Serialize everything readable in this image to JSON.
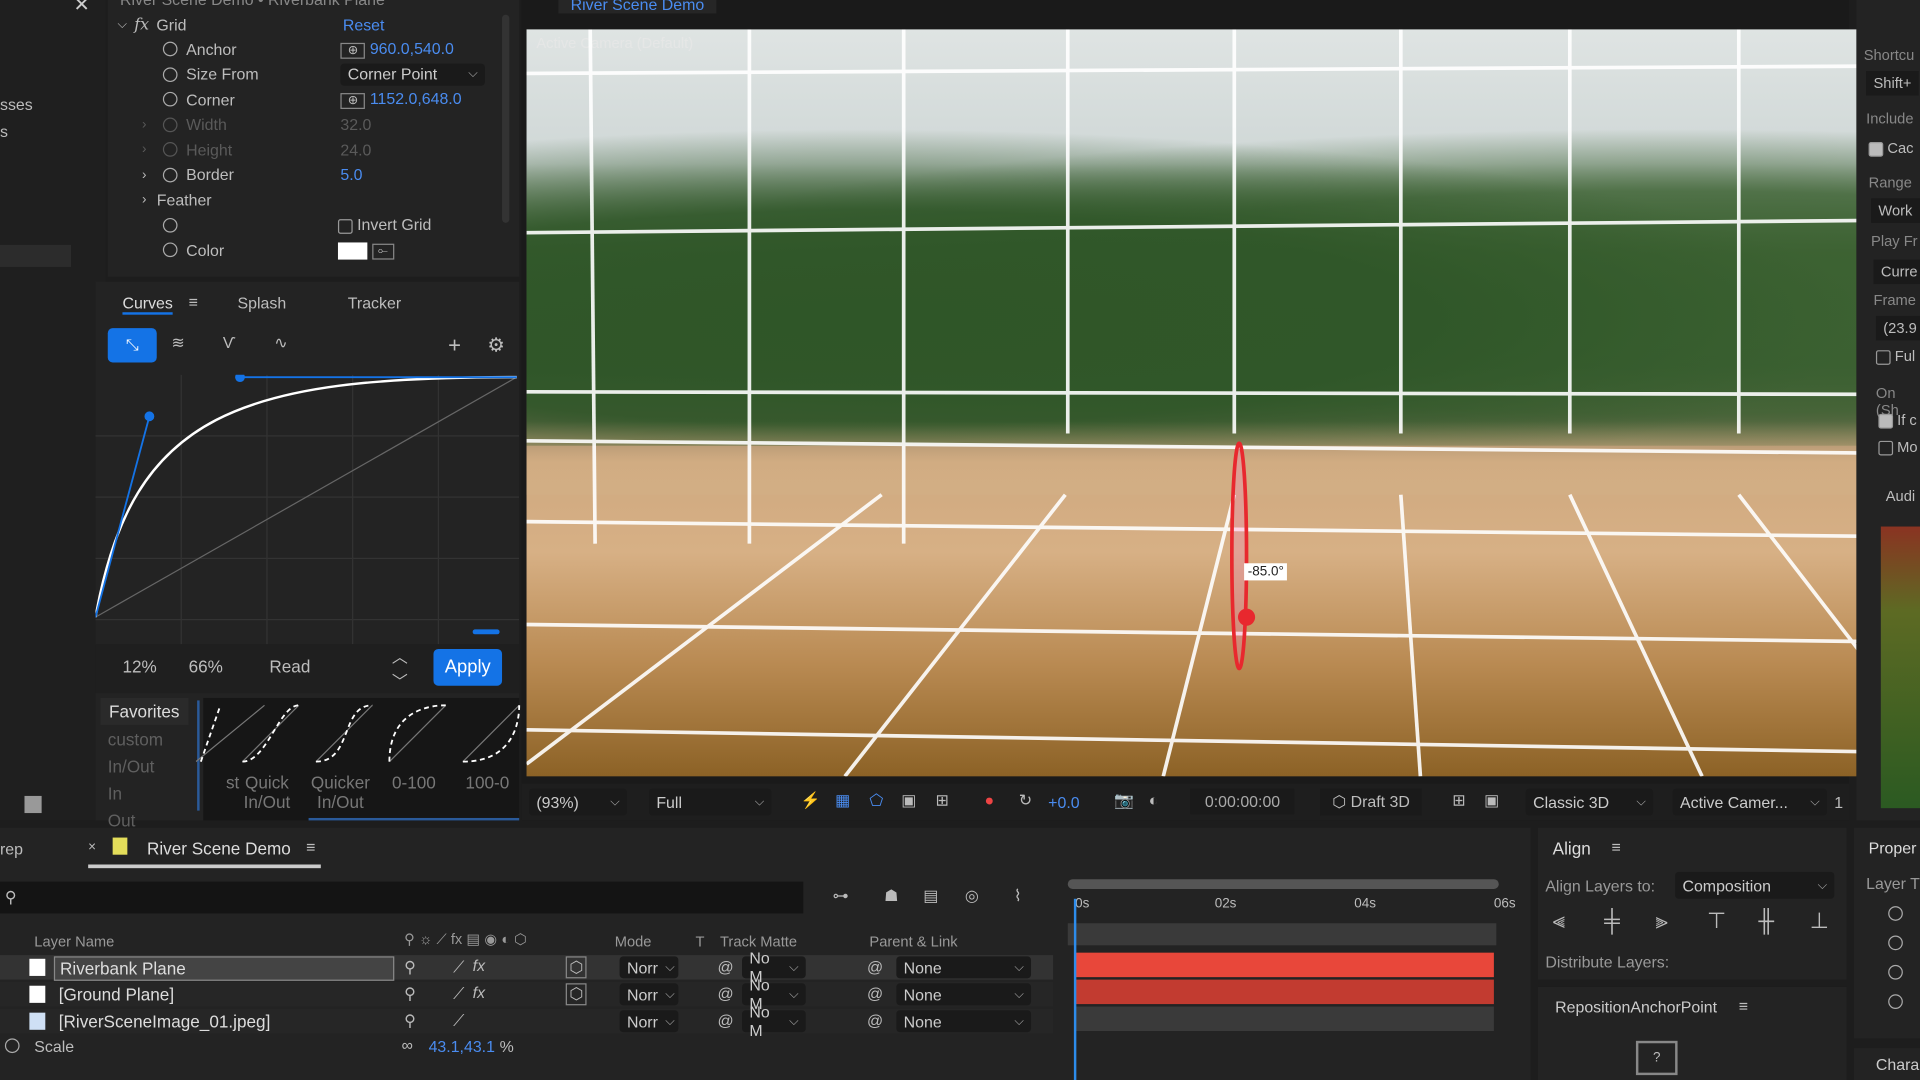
{
  "effect_controls": {
    "header": "River Scene Demo • Riverbank Plane",
    "effect_name": "Grid",
    "reset_label": "Reset",
    "properties": [
      {
        "label": "Anchor",
        "value": "960.0,540.0",
        "type": "point"
      },
      {
        "label": "Size From",
        "value": "Corner Point",
        "type": "dropdown"
      },
      {
        "label": "Corner",
        "value": "1152.0,648.0",
        "type": "point"
      },
      {
        "label": "Width",
        "value": "32.0",
        "type": "disabled"
      },
      {
        "label": "Height",
        "value": "24.0",
        "type": "disabled"
      },
      {
        "label": "Border",
        "value": "5.0",
        "type": "number"
      },
      {
        "label": "Feather",
        "value": "",
        "type": "group"
      },
      {
        "label": "",
        "value": "Invert Grid",
        "type": "checkbox"
      },
      {
        "label": "Color",
        "value": "",
        "type": "color"
      }
    ],
    "color_value": "#ffffff"
  },
  "project_partial": {
    "items": [
      "sses",
      "s"
    ]
  },
  "flow_panel": {
    "tabs": [
      "Curves",
      "Splash",
      "Tracker"
    ],
    "active_tab": "Curves",
    "p1": "12%",
    "p2": "66%",
    "read_label": "Read",
    "apply_label": "Apply",
    "favorites_label": "Favorites",
    "categories": [
      "custom",
      "In/Out",
      "In",
      "Out"
    ],
    "presets": [
      {
        "l1": "",
        "l2": "st"
      },
      {
        "l1": "Quick",
        "l2": "In/Out"
      },
      {
        "l1": "Quicker",
        "l2": "In/Out"
      },
      {
        "l1": "0-100",
        "l2": ""
      },
      {
        "l1": "100-0",
        "l2": ""
      }
    ],
    "accent": "#1473e6"
  },
  "viewer": {
    "tab": "River Scene Demo",
    "camera_label": "Active Camera (Default)",
    "angle_label": "-85.0°",
    "zoom": "(93%)",
    "resolution": "Full",
    "exposure": "+0.0",
    "timecode": "0:00:00:00",
    "draft3d": "Draft 3D",
    "renderer": "Classic 3D",
    "view": "Active Camer...",
    "views_count": "1"
  },
  "preview_panel": {
    "shortcut_label": "Shortcu",
    "shortcut_value": "Shift+",
    "include_label": "Include",
    "cache_label": "Cac",
    "range_label": "Range",
    "range_value": "Work",
    "play_from_label": "Play Fr",
    "play_from_value": "Curre",
    "frame_label": "Frame",
    "frame_value": "(23.9",
    "full_label": "Ful",
    "on_label": "On (Sh",
    "if_label": "If c",
    "mo_label": "Mo",
    "audio_label": "Audi"
  },
  "timeline": {
    "left_tab": "rep",
    "tab": "River Scene Demo",
    "tab_color": "#e3dd5a",
    "columns": {
      "layer_name": "Layer Name",
      "mode": "Mode",
      "t": "T",
      "track_matte": "Track Matte",
      "parent": "Parent & Link"
    },
    "layers": [
      {
        "name": "Riverbank Plane",
        "mode": "Norr",
        "matte": "No M",
        "parent": "None",
        "fx": true,
        "selected": true
      },
      {
        "name": "[Ground Plane]",
        "mode": "Norr",
        "matte": "No M",
        "parent": "None",
        "fx": true,
        "selected": false
      },
      {
        "name": "[RiverSceneImage_01.jpeg]",
        "mode": "Norr",
        "matte": "No M",
        "parent": "None",
        "fx": false,
        "selected": false
      }
    ],
    "property": {
      "label": "Scale",
      "value": "43.1,43.1",
      "unit": "%"
    },
    "ruler": [
      "0s",
      "02s",
      "04s",
      "06s"
    ],
    "bar_color": "#e8473a"
  },
  "align_panel": {
    "title": "Align",
    "align_to_label": "Align Layers to:",
    "align_to_value": "Composition",
    "distribute_label": "Distribute Layers:"
  },
  "anchor_panel": {
    "title": "RepositionAnchorPoint",
    "help": "?"
  },
  "properties_panel": {
    "title": "Proper",
    "layer_label": "Layer T",
    "character_label": "Chara"
  }
}
